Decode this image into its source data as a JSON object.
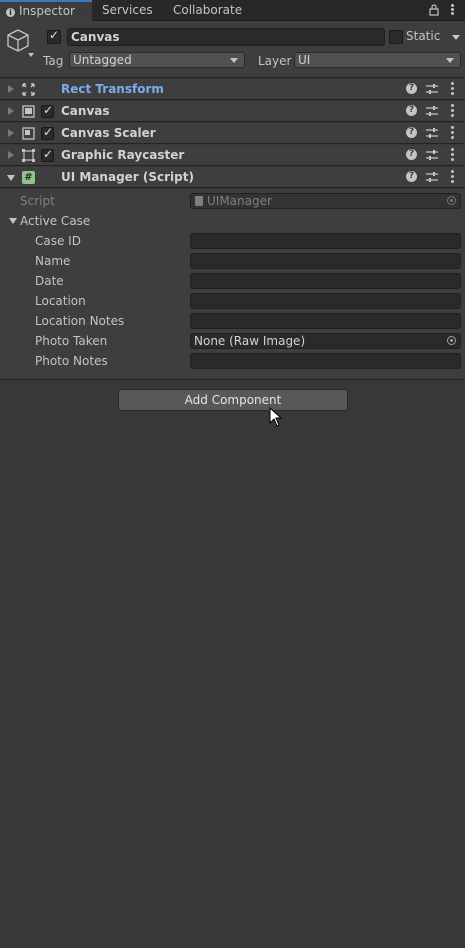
{
  "tabs": {
    "inspector": "Inspector",
    "services": "Services",
    "collaborate": "Collaborate"
  },
  "header": {
    "object_name": "Canvas",
    "static_label": "Static",
    "tag_label": "Tag",
    "tag_value": "Untagged",
    "layer_label": "Layer",
    "layer_value": "UI"
  },
  "components": [
    {
      "title": "Rect Transform",
      "icon": "rect-transform-icon",
      "has_checkbox": false
    },
    {
      "title": "Canvas",
      "icon": "canvas-icon",
      "has_checkbox": true
    },
    {
      "title": "Canvas Scaler",
      "icon": "canvas-scaler-icon",
      "has_checkbox": true
    },
    {
      "title": "Graphic Raycaster",
      "icon": "graphic-raycaster-icon",
      "has_checkbox": true
    },
    {
      "title": "UI Manager (Script)",
      "icon": "script-icon",
      "has_checkbox": false
    }
  ],
  "script": {
    "label": "Script",
    "value": "UIManager"
  },
  "active_case": {
    "label": "Active Case",
    "fields": [
      {
        "label": "Case ID",
        "value": ""
      },
      {
        "label": "Name",
        "value": ""
      },
      {
        "label": "Date",
        "value": ""
      },
      {
        "label": "Location",
        "value": ""
      },
      {
        "label": "Location Notes",
        "value": ""
      },
      {
        "label": "Photo Taken",
        "value": "None (Raw Image)"
      },
      {
        "label": "Photo Notes",
        "value": ""
      }
    ]
  },
  "add_component_label": "Add Component",
  "colors": {
    "accent_blue": "#3a79bb",
    "rect_transform_title": "#7cacee",
    "panel_bg": "#383838"
  }
}
